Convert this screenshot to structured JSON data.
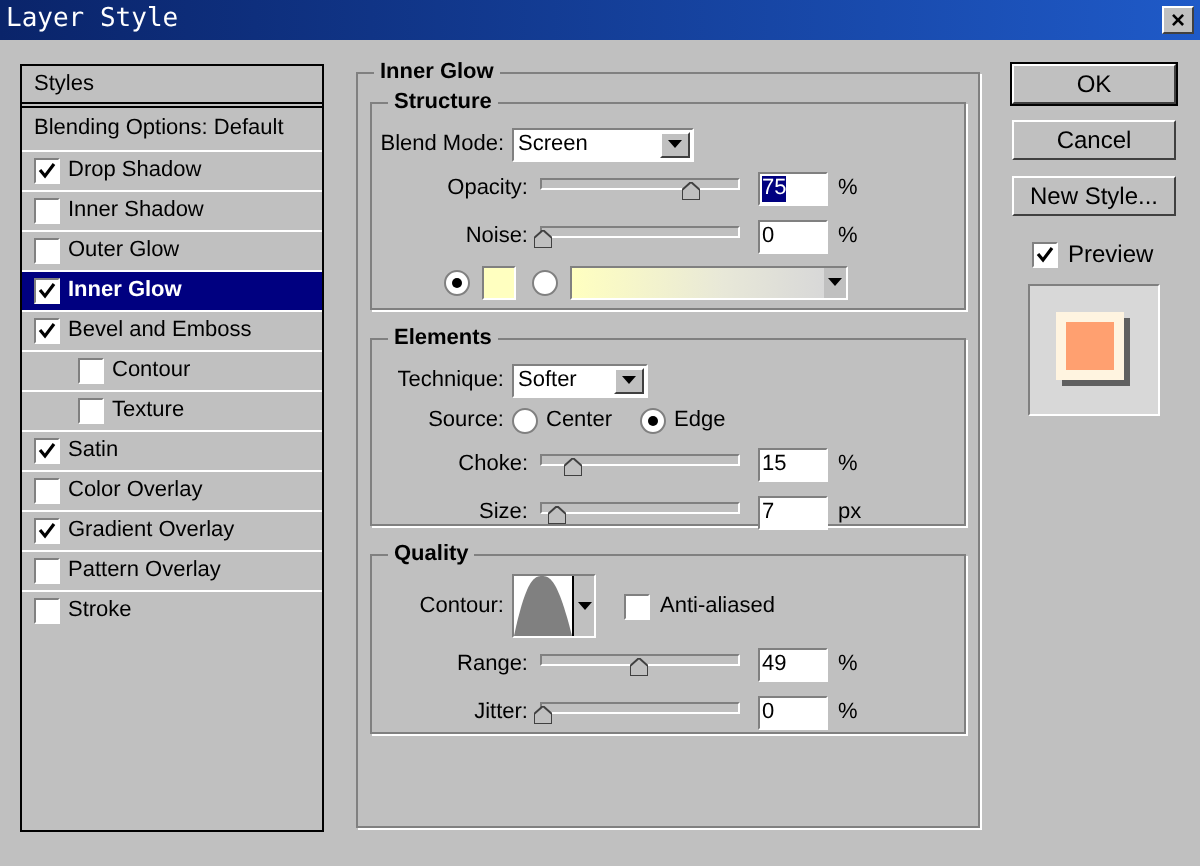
{
  "window": {
    "title": "Layer Style",
    "close": "×"
  },
  "styles_panel": {
    "header": "Styles",
    "blending": "Blending Options: Default",
    "items": [
      {
        "label": "Drop Shadow",
        "checked": true,
        "selected": false
      },
      {
        "label": "Inner Shadow",
        "checked": false,
        "selected": false
      },
      {
        "label": "Outer Glow",
        "checked": false,
        "selected": false
      },
      {
        "label": "Inner Glow",
        "checked": true,
        "selected": true
      },
      {
        "label": "Bevel and Emboss",
        "checked": true,
        "selected": false,
        "children": [
          {
            "label": "Contour",
            "checked": false,
            "selected": false
          },
          {
            "label": "Texture",
            "checked": false,
            "selected": false
          }
        ]
      },
      {
        "label": "Satin",
        "checked": true,
        "selected": false
      },
      {
        "label": "Color Overlay",
        "checked": false,
        "selected": false
      },
      {
        "label": "Gradient Overlay",
        "checked": true,
        "selected": false
      },
      {
        "label": "Pattern Overlay",
        "checked": false,
        "selected": false
      },
      {
        "label": "Stroke",
        "checked": false,
        "selected": false
      }
    ]
  },
  "main": {
    "title": "Inner Glow",
    "structure": {
      "title": "Structure",
      "blend_mode": {
        "label": "Blend Mode:",
        "value": "Screen"
      },
      "sliders": [
        {
          "label": "Opacity:",
          "level": 0.75,
          "value": "75",
          "unit": "%",
          "highlighted": true
        },
        {
          "label": "Noise:",
          "level": 0,
          "value": "0",
          "unit": "%",
          "highlighted": false
        }
      ],
      "fill": [
        {
          "kind": "swatch",
          "selected": true
        },
        {
          "kind": "gradient",
          "selected": false
        }
      ]
    },
    "elements": {
      "title": "Elements",
      "technique": {
        "label": "Technique:",
        "value": "Softer"
      },
      "source": {
        "label": "Source:",
        "options": [
          {
            "label": "Center",
            "selected": false
          },
          {
            "label": "Edge",
            "selected": true
          }
        ]
      },
      "sliders": [
        {
          "label": "Choke:",
          "level": 0.15,
          "value": "15",
          "unit": "%",
          "highlighted": false
        },
        {
          "label": "Size:",
          "level": 0.07,
          "value": "7",
          "unit": "px",
          "highlighted": false
        }
      ]
    },
    "quality": {
      "title": "Quality",
      "contour": {
        "label": "Contour:"
      },
      "anti_aliased": {
        "label": "Anti-aliased",
        "checked": false
      },
      "sliders": [
        {
          "label": "Range:",
          "level": 0.49,
          "value": "49",
          "unit": "%",
          "highlighted": false
        },
        {
          "label": "Jitter:",
          "level": 0,
          "value": "0",
          "unit": "%",
          "highlighted": false
        }
      ]
    }
  },
  "buttons": [
    {
      "label": "OK",
      "default": true
    },
    {
      "label": "Cancel",
      "default": false
    },
    {
      "label": "New Style...",
      "default": false
    }
  ],
  "preview": {
    "label": "Preview",
    "checked": true
  }
}
